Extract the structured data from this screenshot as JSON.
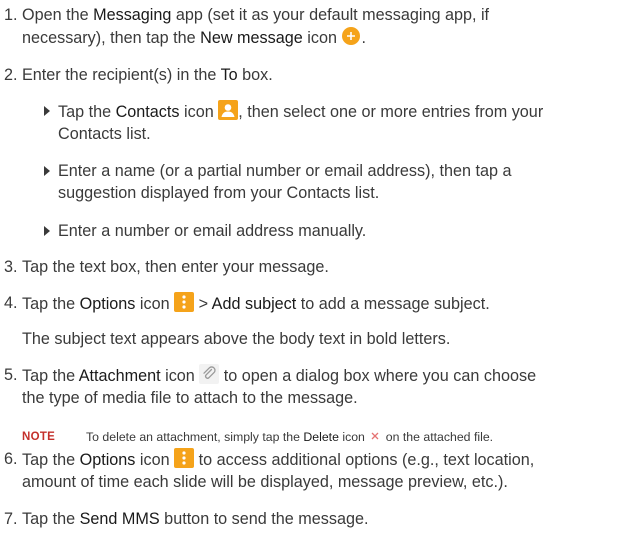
{
  "steps": [
    {
      "num": "1.",
      "a": "Open the ",
      "b1": "Messaging",
      "c": " app (set it as your default messaging app, if",
      "line2a": "necessary), then tap the ",
      "b2": "New message",
      "line2b": " icon",
      "end": "."
    },
    {
      "num": "2.",
      "a": "Enter the recipient(s) in the ",
      "b1": "To",
      "c": " box."
    },
    {
      "num": "3.",
      "a": "Tap the text box, then enter your message."
    },
    {
      "num": "4.",
      "a": "Tap the ",
      "b1": "Options",
      "c": " icon",
      "d": " > ",
      "b2": "Add subject",
      "e": " to add a message subject."
    },
    {
      "num": "5.",
      "a": "Tap the ",
      "b1": "Attachment",
      "c": " icon",
      "d": " to open a dialog box where you can choose",
      "line2": "the type of media file to attach to the message."
    },
    {
      "num": "6.",
      "a": "Tap the ",
      "b1": "Options",
      "c": " icon",
      "d": " to access additional options (e.g., text location,",
      "line2": "amount of time each slide will be displayed, message preview, etc.)."
    },
    {
      "num": "7.",
      "a": "Tap the ",
      "b1": "Send MMS",
      "c": " button to send the message."
    }
  ],
  "sub": [
    {
      "a": "Tap the ",
      "b": "Contacts",
      "c": " icon",
      "d": ", then select one or more entries from your",
      "line2": "Contacts list."
    },
    {
      "a": "Enter a name (or a partial number or email address), then tap a",
      "line2": "suggestion displayed from your Contacts list."
    },
    {
      "a": "Enter a number or email address manually."
    }
  ],
  "para4": "The subject text appears above the body text in bold letters.",
  "note": {
    "label": "NOTE",
    "a": "To delete an attachment, simply tap the ",
    "b": "Delete",
    "c": " icon",
    "d": " on the attached file."
  },
  "colors": {
    "accent": "#f5a31a",
    "note_red": "#c4302b"
  },
  "icons": [
    "new-message-icon",
    "contacts-icon",
    "options-icon",
    "attachment-icon",
    "delete-icon"
  ]
}
